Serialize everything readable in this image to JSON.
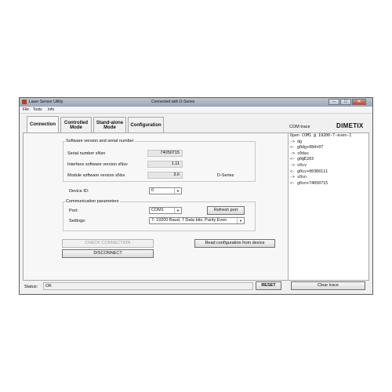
{
  "window": {
    "title": "Laser Sensor Utility",
    "connection_status": "Connected with D-Series",
    "controls": {
      "minimize": "–",
      "maximize": "□",
      "close": "✕"
    }
  },
  "menu": {
    "items": [
      "File",
      "Tools",
      "Info"
    ]
  },
  "tabs": [
    {
      "label": "Connection",
      "active": true
    },
    {
      "label": "Controlled Mode",
      "active": false
    },
    {
      "label": "Stand-alone Mode",
      "active": false
    },
    {
      "label": "Configuration",
      "active": false
    }
  ],
  "software_group": {
    "title": "Software version and serial number",
    "serial_label": "Serial number sNsn",
    "serial_value": "74050715",
    "interface_label": "Interface software version sNsv",
    "interface_value": "1.11",
    "module_label": "Module software version sNsv",
    "module_value": "3.6",
    "series": "D-Series"
  },
  "device": {
    "label": "Device ID:",
    "value": "0"
  },
  "comm_group": {
    "title": "Communication parameters",
    "port_label": "Port:",
    "port_value": "COM1",
    "refresh_label": "Refresh port",
    "settings_label": "Settings:",
    "settings_value": "7: 19200 Baud, 7 Data bits, Parity Even"
  },
  "buttons": {
    "check_connection": "CHECK CONNECTION",
    "disconnect": "DISCONNECT",
    "read_config": "Read configuration from device",
    "reset": "RESET",
    "clear_trace": "Clear trace"
  },
  "status": {
    "label": "Status:",
    "value": "OK"
  },
  "trace": {
    "title": "COM trace",
    "brand": "DIMETIX",
    "lines": [
      "Open COM1 @ 19200-7-even-1",
      "-> dg",
      "<- g0dg+084+07",
      "-> s0dac",
      "<- g0@E203",
      "-> s0sv",
      "<- g0sv+00360111",
      "-> s0sn",
      "<- g0sn+74050715"
    ]
  }
}
